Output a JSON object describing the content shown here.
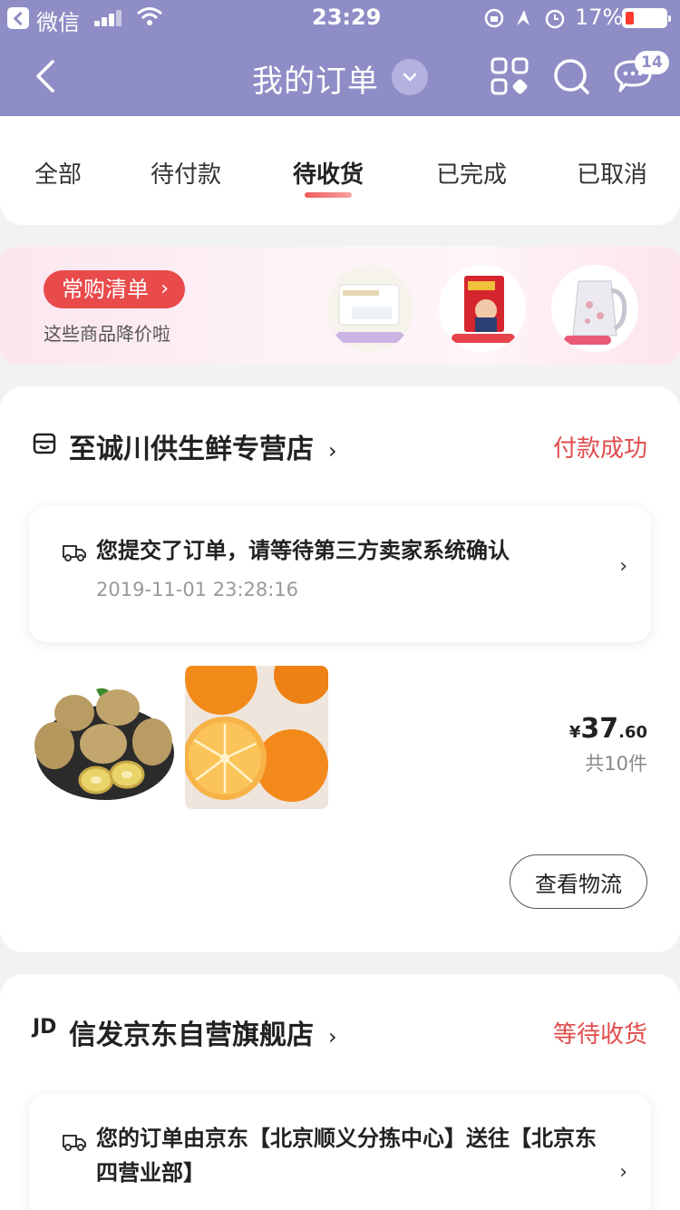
{
  "status_bar": {
    "app_name": "微信",
    "time": "23:29",
    "battery": "17%"
  },
  "header": {
    "title": "我的订单",
    "message_count": "14"
  },
  "tabs": [
    {
      "label": "全部",
      "active": false
    },
    {
      "label": "待付款",
      "active": false
    },
    {
      "label": "待收货",
      "active": true
    },
    {
      "label": "已完成",
      "active": false
    },
    {
      "label": "已取消",
      "active": false
    }
  ],
  "banner": {
    "pill_label": "常购清单",
    "subtitle": "这些商品降价啦"
  },
  "orders": [
    {
      "shop_name": "至诚川供生鲜专营店",
      "status": "付款成功",
      "tracking_text": "您提交了订单，请等待第三方卖家系统确认",
      "tracking_time": "2019-11-01 23:28:16",
      "price_symbol": "¥",
      "price_int": "37",
      "price_dec": ".60",
      "count": "共10件",
      "button_label": "查看物流"
    },
    {
      "shop_logo_text": "JD",
      "shop_name": "信发京东自营旗舰店",
      "status": "等待收货",
      "tracking_text": "您的订单由京东【北京顺义分拣中心】送往【北京东四营业部】"
    }
  ],
  "colors": {
    "header_bg": "#8f8dc6",
    "accent_red": "#e04c4c"
  }
}
